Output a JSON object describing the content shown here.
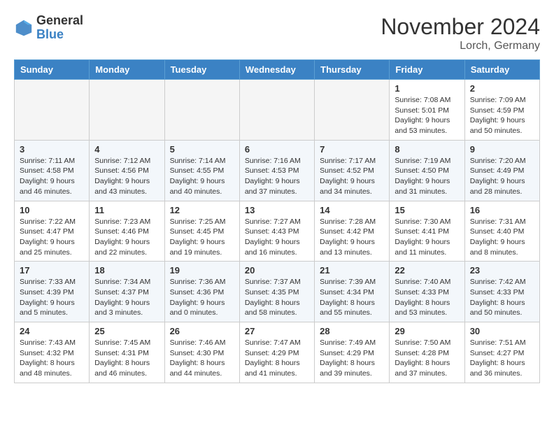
{
  "header": {
    "logo": {
      "line1": "General",
      "line2": "Blue"
    },
    "title": "November 2024",
    "subtitle": "Lorch, Germany"
  },
  "weekdays": [
    "Sunday",
    "Monday",
    "Tuesday",
    "Wednesday",
    "Thursday",
    "Friday",
    "Saturday"
  ],
  "weeks": [
    [
      {
        "day": "",
        "info": ""
      },
      {
        "day": "",
        "info": ""
      },
      {
        "day": "",
        "info": ""
      },
      {
        "day": "",
        "info": ""
      },
      {
        "day": "",
        "info": ""
      },
      {
        "day": "1",
        "info": "Sunrise: 7:08 AM\nSunset: 5:01 PM\nDaylight: 9 hours and 53 minutes."
      },
      {
        "day": "2",
        "info": "Sunrise: 7:09 AM\nSunset: 4:59 PM\nDaylight: 9 hours and 50 minutes."
      }
    ],
    [
      {
        "day": "3",
        "info": "Sunrise: 7:11 AM\nSunset: 4:58 PM\nDaylight: 9 hours and 46 minutes."
      },
      {
        "day": "4",
        "info": "Sunrise: 7:12 AM\nSunset: 4:56 PM\nDaylight: 9 hours and 43 minutes."
      },
      {
        "day": "5",
        "info": "Sunrise: 7:14 AM\nSunset: 4:55 PM\nDaylight: 9 hours and 40 minutes."
      },
      {
        "day": "6",
        "info": "Sunrise: 7:16 AM\nSunset: 4:53 PM\nDaylight: 9 hours and 37 minutes."
      },
      {
        "day": "7",
        "info": "Sunrise: 7:17 AM\nSunset: 4:52 PM\nDaylight: 9 hours and 34 minutes."
      },
      {
        "day": "8",
        "info": "Sunrise: 7:19 AM\nSunset: 4:50 PM\nDaylight: 9 hours and 31 minutes."
      },
      {
        "day": "9",
        "info": "Sunrise: 7:20 AM\nSunset: 4:49 PM\nDaylight: 9 hours and 28 minutes."
      }
    ],
    [
      {
        "day": "10",
        "info": "Sunrise: 7:22 AM\nSunset: 4:47 PM\nDaylight: 9 hours and 25 minutes."
      },
      {
        "day": "11",
        "info": "Sunrise: 7:23 AM\nSunset: 4:46 PM\nDaylight: 9 hours and 22 minutes."
      },
      {
        "day": "12",
        "info": "Sunrise: 7:25 AM\nSunset: 4:45 PM\nDaylight: 9 hours and 19 minutes."
      },
      {
        "day": "13",
        "info": "Sunrise: 7:27 AM\nSunset: 4:43 PM\nDaylight: 9 hours and 16 minutes."
      },
      {
        "day": "14",
        "info": "Sunrise: 7:28 AM\nSunset: 4:42 PM\nDaylight: 9 hours and 13 minutes."
      },
      {
        "day": "15",
        "info": "Sunrise: 7:30 AM\nSunset: 4:41 PM\nDaylight: 9 hours and 11 minutes."
      },
      {
        "day": "16",
        "info": "Sunrise: 7:31 AM\nSunset: 4:40 PM\nDaylight: 9 hours and 8 minutes."
      }
    ],
    [
      {
        "day": "17",
        "info": "Sunrise: 7:33 AM\nSunset: 4:39 PM\nDaylight: 9 hours and 5 minutes."
      },
      {
        "day": "18",
        "info": "Sunrise: 7:34 AM\nSunset: 4:37 PM\nDaylight: 9 hours and 3 minutes."
      },
      {
        "day": "19",
        "info": "Sunrise: 7:36 AM\nSunset: 4:36 PM\nDaylight: 9 hours and 0 minutes."
      },
      {
        "day": "20",
        "info": "Sunrise: 7:37 AM\nSunset: 4:35 PM\nDaylight: 8 hours and 58 minutes."
      },
      {
        "day": "21",
        "info": "Sunrise: 7:39 AM\nSunset: 4:34 PM\nDaylight: 8 hours and 55 minutes."
      },
      {
        "day": "22",
        "info": "Sunrise: 7:40 AM\nSunset: 4:33 PM\nDaylight: 8 hours and 53 minutes."
      },
      {
        "day": "23",
        "info": "Sunrise: 7:42 AM\nSunset: 4:33 PM\nDaylight: 8 hours and 50 minutes."
      }
    ],
    [
      {
        "day": "24",
        "info": "Sunrise: 7:43 AM\nSunset: 4:32 PM\nDaylight: 8 hours and 48 minutes."
      },
      {
        "day": "25",
        "info": "Sunrise: 7:45 AM\nSunset: 4:31 PM\nDaylight: 8 hours and 46 minutes."
      },
      {
        "day": "26",
        "info": "Sunrise: 7:46 AM\nSunset: 4:30 PM\nDaylight: 8 hours and 44 minutes."
      },
      {
        "day": "27",
        "info": "Sunrise: 7:47 AM\nSunset: 4:29 PM\nDaylight: 8 hours and 41 minutes."
      },
      {
        "day": "28",
        "info": "Sunrise: 7:49 AM\nSunset: 4:29 PM\nDaylight: 8 hours and 39 minutes."
      },
      {
        "day": "29",
        "info": "Sunrise: 7:50 AM\nSunset: 4:28 PM\nDaylight: 8 hours and 37 minutes."
      },
      {
        "day": "30",
        "info": "Sunrise: 7:51 AM\nSunset: 4:27 PM\nDaylight: 8 hours and 36 minutes."
      }
    ]
  ]
}
